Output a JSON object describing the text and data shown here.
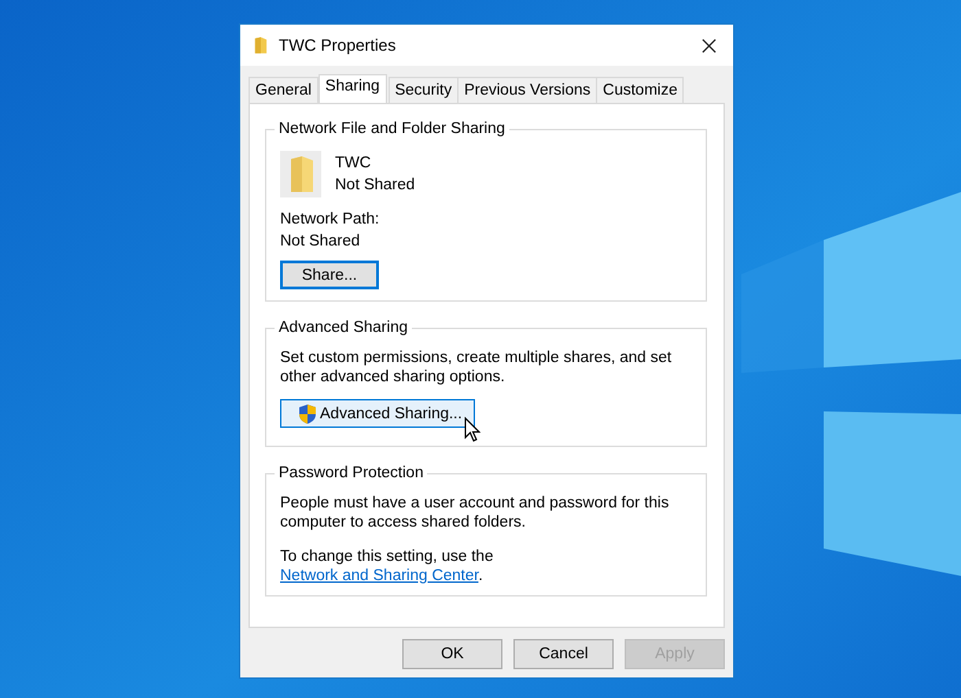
{
  "window": {
    "title": "TWC Properties"
  },
  "tabs": [
    {
      "label": "General",
      "selected": false
    },
    {
      "label": "Sharing",
      "selected": true
    },
    {
      "label": "Security",
      "selected": false
    },
    {
      "label": "Previous Versions",
      "selected": false
    },
    {
      "label": "Customize",
      "selected": false
    }
  ],
  "groups": [
    {
      "kind": "network",
      "title": "Network File and Folder Sharing",
      "folder_name": "TWC",
      "folder_status": "Not Shared",
      "path_label": "Network Path:",
      "path_value": "Not Shared",
      "button": {
        "label": "Share...",
        "focused": true,
        "hovered": false
      }
    },
    {
      "kind": "advanced",
      "title": "Advanced Sharing",
      "description": "Set custom permissions, create multiple shares, and set other advanced sharing options.",
      "button": {
        "label": "Advanced Sharing...",
        "focused": false,
        "hovered": true
      }
    },
    {
      "kind": "password",
      "title": "Password Protection",
      "description": "People must have a user account and password for this computer to access shared folders.",
      "note": {
        "prefix": "To change this setting, use the ",
        "link": "Network and Sharing Center",
        "suffix": "."
      }
    }
  ],
  "buttons": [
    {
      "label": "OK",
      "disabled": false
    },
    {
      "label": "Cancel",
      "disabled": false
    },
    {
      "label": "Apply",
      "disabled": true
    }
  ]
}
